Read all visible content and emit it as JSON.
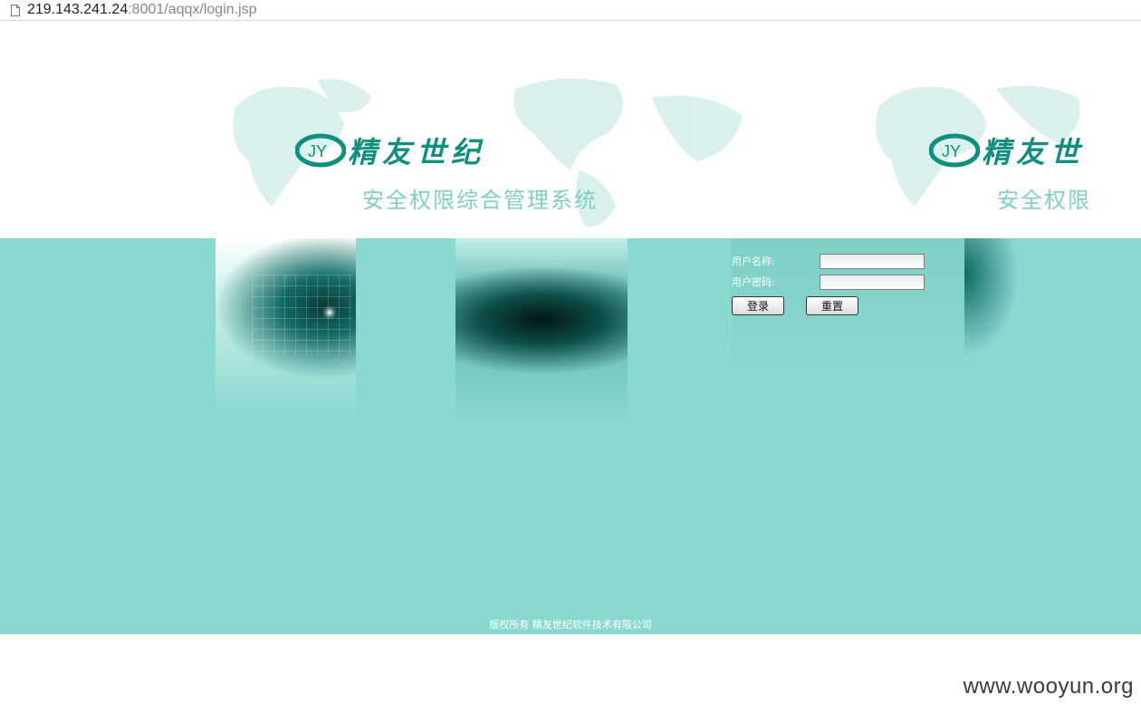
{
  "address_bar": {
    "url_host": "219.143.241.24",
    "url_rest": ":8001/aqqx/login.jsp"
  },
  "header": {
    "logo_text": "精友世纪",
    "logo_text_right": "精友世",
    "system_title": "安全权限综合管理系统",
    "system_title_right": "安全权限"
  },
  "login": {
    "username_label": "用户名称:",
    "password_label": "用户密码:",
    "username_value": "",
    "password_value": "",
    "login_button": "登录",
    "reset_button": "重置"
  },
  "footer": {
    "copyright": "版权所有  精友世纪软件技术有限公司"
  },
  "watermark": "www.wooyun.org",
  "colors": {
    "teal_background": "#8ad9d0",
    "logo_green": "#0f8f80",
    "subtitle_teal": "#7fcfc4"
  }
}
